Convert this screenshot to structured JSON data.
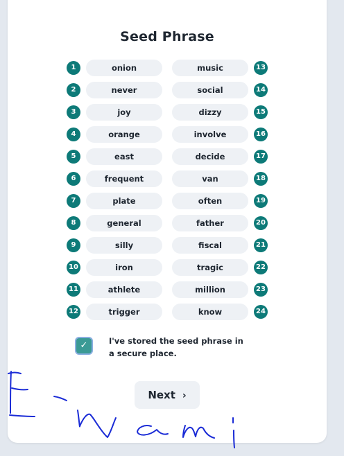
{
  "title": "Seed Phrase",
  "words": [
    {
      "n": "1",
      "w": "onion"
    },
    {
      "n": "2",
      "w": "never"
    },
    {
      "n": "3",
      "w": "joy"
    },
    {
      "n": "4",
      "w": "orange"
    },
    {
      "n": "5",
      "w": "east"
    },
    {
      "n": "6",
      "w": "frequent"
    },
    {
      "n": "7",
      "w": "plate"
    },
    {
      "n": "8",
      "w": "general"
    },
    {
      "n": "9",
      "w": "silly"
    },
    {
      "n": "10",
      "w": "iron"
    },
    {
      "n": "11",
      "w": "athlete"
    },
    {
      "n": "12",
      "w": "trigger"
    },
    {
      "n": "13",
      "w": "music"
    },
    {
      "n": "14",
      "w": "social"
    },
    {
      "n": "15",
      "w": "dizzy"
    },
    {
      "n": "16",
      "w": "involve"
    },
    {
      "n": "17",
      "w": "decide"
    },
    {
      "n": "18",
      "w": "van"
    },
    {
      "n": "19",
      "w": "often"
    },
    {
      "n": "20",
      "w": "father"
    },
    {
      "n": "21",
      "w": "fiscal"
    },
    {
      "n": "22",
      "w": "tragic"
    },
    {
      "n": "23",
      "w": "million"
    },
    {
      "n": "24",
      "w": "know"
    }
  ],
  "confirm": {
    "checked": true,
    "label": "I've stored the seed phrase in a secure place."
  },
  "next_button": {
    "label": "Next"
  },
  "colors": {
    "accent": "#0d7a78",
    "pill": "#eef1f5",
    "ink": "#1e2630",
    "scribble": "#1a2bd6"
  }
}
